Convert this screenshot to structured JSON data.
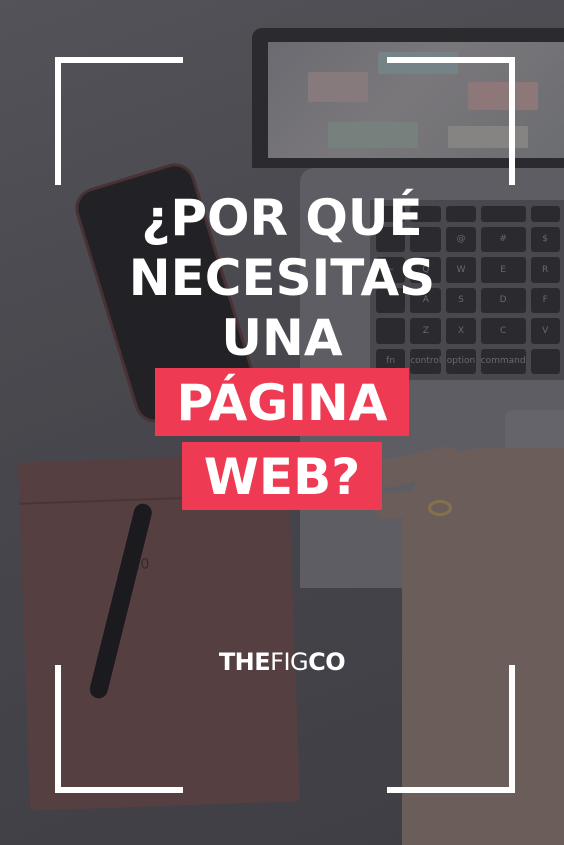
{
  "headline": {
    "line1": "¿POR QUÉ",
    "line2": "NECESITAS",
    "line3": "UNA",
    "highlight1": "PÁGINA",
    "highlight2": "WEB?"
  },
  "brand": {
    "part1": "THE",
    "part2": "FIG",
    "part3": "CO"
  },
  "background": {
    "keys": [
      "",
      "",
      "",
      "",
      "",
      "",
      "",
      "",
      "@",
      "#",
      "$",
      "%",
      "~",
      "Q",
      "W",
      "E",
      "R",
      "T",
      "",
      "A",
      "S",
      "D",
      "F",
      "G",
      "",
      "Z",
      "X",
      "C",
      "V",
      "",
      "fn",
      "control",
      "option",
      "command",
      "",
      ""
    ],
    "notebook_year": "20"
  },
  "colors": {
    "accent": "#ee3a52",
    "text": "#ffffff",
    "frame": "#ffffff"
  }
}
